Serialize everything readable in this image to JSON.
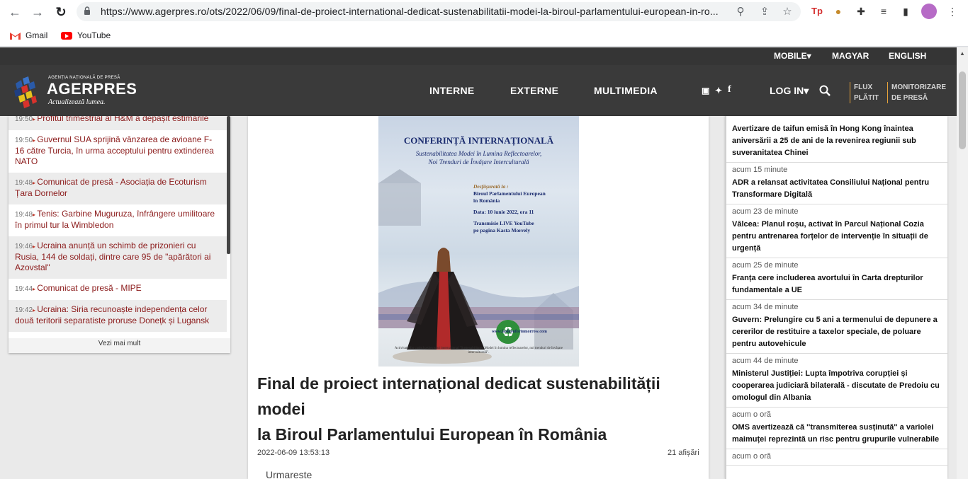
{
  "browser": {
    "url": "https://www.agerpres.ro/ots/2022/06/09/final-de-proiect-international-dedicat-sustenabilitatii-modei-la-biroul-parlamentului-european-in-ro...",
    "bookmarks": [
      {
        "label": "Gmail",
        "icon": "gmail-icon"
      },
      {
        "label": "YouTube",
        "icon": "youtube-icon"
      }
    ],
    "accent": "#ffffff"
  },
  "site": {
    "top_links": [
      "MOBILE▾",
      "MAGYAR",
      "ENGLISH"
    ],
    "logo_tagline": "AGENȚIA NAȚIONALĂ DE PRESĂ",
    "logo_name": "AGERPRES",
    "logo_slogan": "Actualizează lumea.",
    "nav": [
      "INTERNE",
      "EXTERNE",
      "MULTIMEDIA"
    ],
    "login": "LOG IN▾",
    "flux_line1": "FLUX",
    "flux_line2": "PLĂTIT",
    "monitor_line1": "MONITORIZARE",
    "monitor_line2": "DE PRESĂ",
    "header_bg": "#3a3a3a"
  },
  "left_news": {
    "items": [
      {
        "time": "19:50",
        "title": "Profitul trimestrial al H&M a depășit estimările",
        "shaded": true
      },
      {
        "time": "19:50",
        "title": "Guvernul SUA sprijină vânzarea de avioane F-16 către Turcia, în urma acceptului pentru extinderea NATO",
        "shaded": false
      },
      {
        "time": "19:48",
        "title": "Comunicat de presă - Asociația de Ecoturism Țara Dornelor",
        "shaded": true
      },
      {
        "time": "19:48",
        "title": "Tenis: Garbine Muguruza, înfrângere umilitoare în primul tur la Wimbledon",
        "shaded": false
      },
      {
        "time": "19:46",
        "title": "Ucraina anunță un schimb de prizonieri cu Rusia, 144 de soldați, dintre care 95 de \"apărători ai Azovstal\"",
        "shaded": true
      },
      {
        "time": "19:44",
        "title": "Comunicat de presă - MIPE",
        "shaded": false
      },
      {
        "time": "19:42",
        "title": "Ucraina: Siria recunoaște independența celor două teritorii separatiste proruse Donețk și Lugansk",
        "shaded": true
      }
    ],
    "more_label": "Vezi mai mult"
  },
  "article": {
    "poster": {
      "title": "CONFERINȚĂ INTERNAȚIONALĂ",
      "subtitle1": "Sustenabilitatea Modei în Lumina Reflectoarelor,",
      "subtitle2": "Noi Trenduri de Învățare Interculturală",
      "venue_label": "Desfășurată la :",
      "venue1": "Biroul Parlamentului European",
      "venue2": "în România",
      "date": "Data: 10 iunie 2022, ora 11",
      "stream1": "Transmisie LIVE YouTube",
      "stream2": "pe pagina Kasta Morrely",
      "website": "www.fashionfortomorrow.com",
      "footer": "Activitate din cadrul proiectului internațional \"Sustenabilitatea Modei în lumina reflectoarelor, noi trenduri de învățare interculturală\"."
    },
    "title_line1": "Final de proiect internațional dedicat sustenabilității",
    "title_line2": "modei",
    "title_line3": "la Biroul Parlamentului European în România",
    "date": "2022-06-09 13:53:13",
    "views": "21 afișări",
    "follow": "Urmareste"
  },
  "right_news": {
    "items": [
      {
        "time": "",
        "title": "Avertizare de taifun emisă în Hong Kong înaintea aniversării a 25 de ani de la revenirea regiunii sub suveranitatea Chinei"
      },
      {
        "time": "acum 15 minute",
        "title": "ADR a relansat activitatea Consiliului Național pentru Transformare Digitală"
      },
      {
        "time": "acum 23 de minute",
        "title": "Vâlcea: Planul roșu, activat în Parcul Național Cozia pentru antrenarea forțelor de intervenție în situații de urgență"
      },
      {
        "time": "acum 25 de minute",
        "title": "Franța cere includerea avortului în Carta drepturilor fundamentale a UE"
      },
      {
        "time": "acum 34 de minute",
        "title": "Guvern: Prelungire cu 5 ani a termenului de depunere a cererilor de restituire a taxelor speciale, de poluare pentru autovehicule"
      },
      {
        "time": "acum 44 de minute",
        "title": "Ministerul Justiției: Lupta împotriva corupției și cooperarea judiciară bilaterală - discutate de Predoiu cu omologul din Albania"
      },
      {
        "time": "acum o oră",
        "title": "OMS avertizează că ''transmiterea susținută'' a variolei maimuței reprezintă un risc pentru grupurile vulnerabile"
      },
      {
        "time": "acum o oră",
        "title": ""
      }
    ]
  }
}
